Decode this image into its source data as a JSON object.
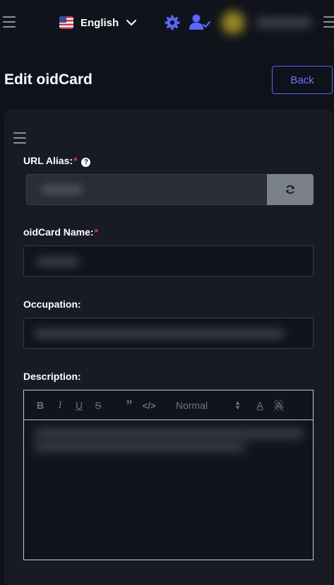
{
  "topbar": {
    "language": "English",
    "icons": {
      "left_menu": "menu-icon",
      "flag": "us-flag-icon",
      "chevron": "chevron-down-icon",
      "settings": "settings-icon",
      "user": "user-check-icon",
      "right_menu": "menu-icon"
    }
  },
  "page": {
    "title": "Edit oidCard",
    "back_label": "Back"
  },
  "form": {
    "url_alias_label": "URL Alias:",
    "required_mark": "*",
    "help_glyph": "?",
    "name_label": "oidCard Name:",
    "occupation_label": "Occupation:",
    "description_label": "Description:",
    "refresh_icon": "refresh-icon"
  },
  "editor": {
    "bold": "B",
    "italic": "I",
    "underline": "U",
    "strike": "S",
    "quote": "”",
    "code": "</>",
    "header_select": "Normal",
    "color": "A",
    "background": "A"
  },
  "colors": {
    "background": "#0f121a",
    "card": "#181b24",
    "accent": "#5663ff",
    "required": "#e03b4a"
  }
}
